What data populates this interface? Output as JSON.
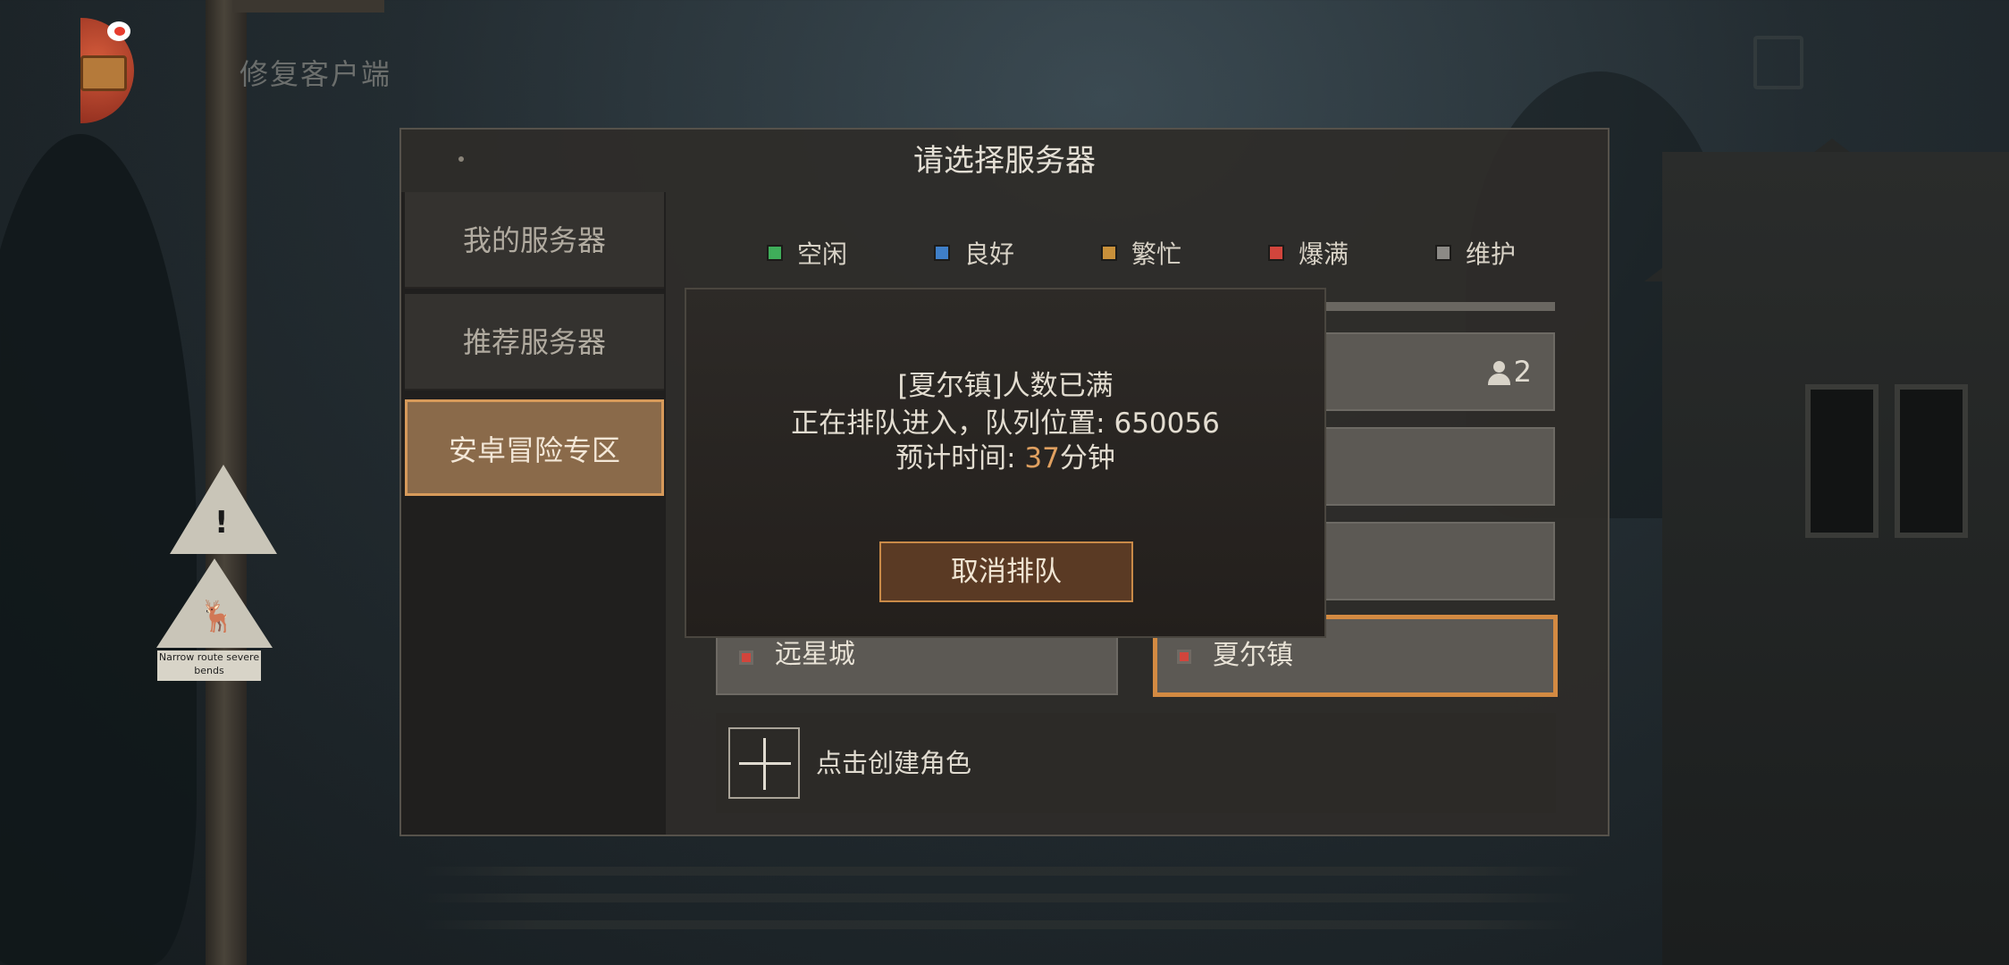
{
  "top": {
    "repair_client_label": "修复客户端",
    "app_icon": "treasure-chest-icon",
    "corner_icon": "square-icon"
  },
  "scenery": {
    "road_sign_text": "Narrow route severe bends"
  },
  "dialog": {
    "title": "请选择服务器",
    "tabs": [
      {
        "label": "我的服务器",
        "active": false
      },
      {
        "label": "推荐服务器",
        "active": false
      },
      {
        "label": "安卓冒险专区",
        "active": true
      }
    ],
    "legend": [
      {
        "label": "空闲",
        "color": "#3fae5a"
      },
      {
        "label": "良好",
        "color": "#3f7fc8"
      },
      {
        "label": "繁忙",
        "color": "#c8903a"
      },
      {
        "label": "爆满",
        "color": "#d2453c"
      },
      {
        "label": "维护",
        "color": "#8c8a86"
      }
    ],
    "servers": [
      {
        "name": "远星城",
        "status": "爆满",
        "selected": false
      },
      {
        "name": "夏尔镇",
        "status": "爆满",
        "selected": true
      }
    ],
    "player_count": "2",
    "create_role_label": "点击创建角色"
  },
  "queue_popup": {
    "line1": "[夏尔镇]人数已满",
    "line2": "正在排队进入，队列位置: 650056",
    "line3_prefix": "预计时间: ",
    "minutes": "37",
    "line3_suffix": "分钟",
    "cancel_label": "取消排队"
  }
}
